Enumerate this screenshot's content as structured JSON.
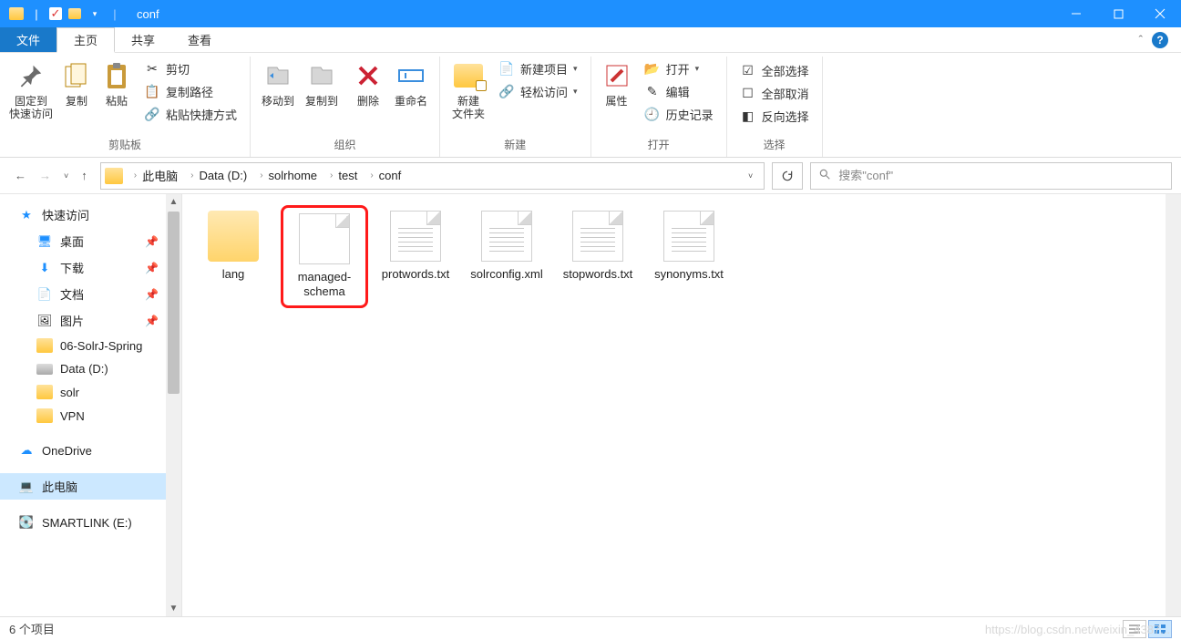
{
  "title": "conf",
  "tabs": {
    "file": "文件",
    "home": "主页",
    "share": "共享",
    "view": "查看"
  },
  "ribbon": {
    "clipboard": {
      "label": "剪贴板",
      "pin": "固定到\n快速访问",
      "copy": "复制",
      "paste": "粘贴",
      "cut": "剪切",
      "copy_path": "复制路径",
      "paste_shortcut": "粘贴快捷方式"
    },
    "organize": {
      "label": "组织",
      "move_to": "移动到",
      "copy_to": "复制到",
      "delete": "删除",
      "rename": "重命名"
    },
    "new": {
      "label": "新建",
      "new_folder": "新建\n文件夹",
      "new_item": "新建项目",
      "easy_access": "轻松访问"
    },
    "open": {
      "label": "打开",
      "properties": "属性",
      "open": "打开",
      "edit": "编辑",
      "history": "历史记录"
    },
    "select": {
      "label": "选择",
      "select_all": "全部选择",
      "deselect": "全部取消",
      "invert": "反向选择"
    }
  },
  "breadcrumb": [
    "此电脑",
    "Data (D:)",
    "solrhome",
    "test",
    "conf"
  ],
  "search_placeholder": "搜索\"conf\"",
  "sidebar": {
    "quick_access": "快速访问",
    "items": [
      {
        "icon": "desktop",
        "label": "桌面",
        "pinned": true
      },
      {
        "icon": "download",
        "label": "下载",
        "pinned": true
      },
      {
        "icon": "docs",
        "label": "文档",
        "pinned": true
      },
      {
        "icon": "pictures",
        "label": "图片",
        "pinned": true
      },
      {
        "icon": "folder",
        "label": "06-SolrJ-Spring",
        "pinned": false
      },
      {
        "icon": "disk",
        "label": "Data (D:)",
        "pinned": false
      },
      {
        "icon": "folder",
        "label": "solr",
        "pinned": false
      },
      {
        "icon": "folder",
        "label": "VPN",
        "pinned": false
      }
    ],
    "onedrive": "OneDrive",
    "this_pc": "此电脑",
    "smartlink": "SMARTLINK (E:)"
  },
  "files": [
    {
      "name": "lang",
      "type": "folder",
      "highlighted": false
    },
    {
      "name": "managed-schema",
      "type": "blank",
      "highlighted": true
    },
    {
      "name": "protwords.txt",
      "type": "text",
      "highlighted": false
    },
    {
      "name": "solrconfig.xml",
      "type": "text",
      "highlighted": false
    },
    {
      "name": "stopwords.txt",
      "type": "text",
      "highlighted": false
    },
    {
      "name": "synonyms.txt",
      "type": "text",
      "highlighted": false
    }
  ],
  "status": "6 个项目",
  "watermark": "https://blog.csdn.net/weixin_4387..."
}
